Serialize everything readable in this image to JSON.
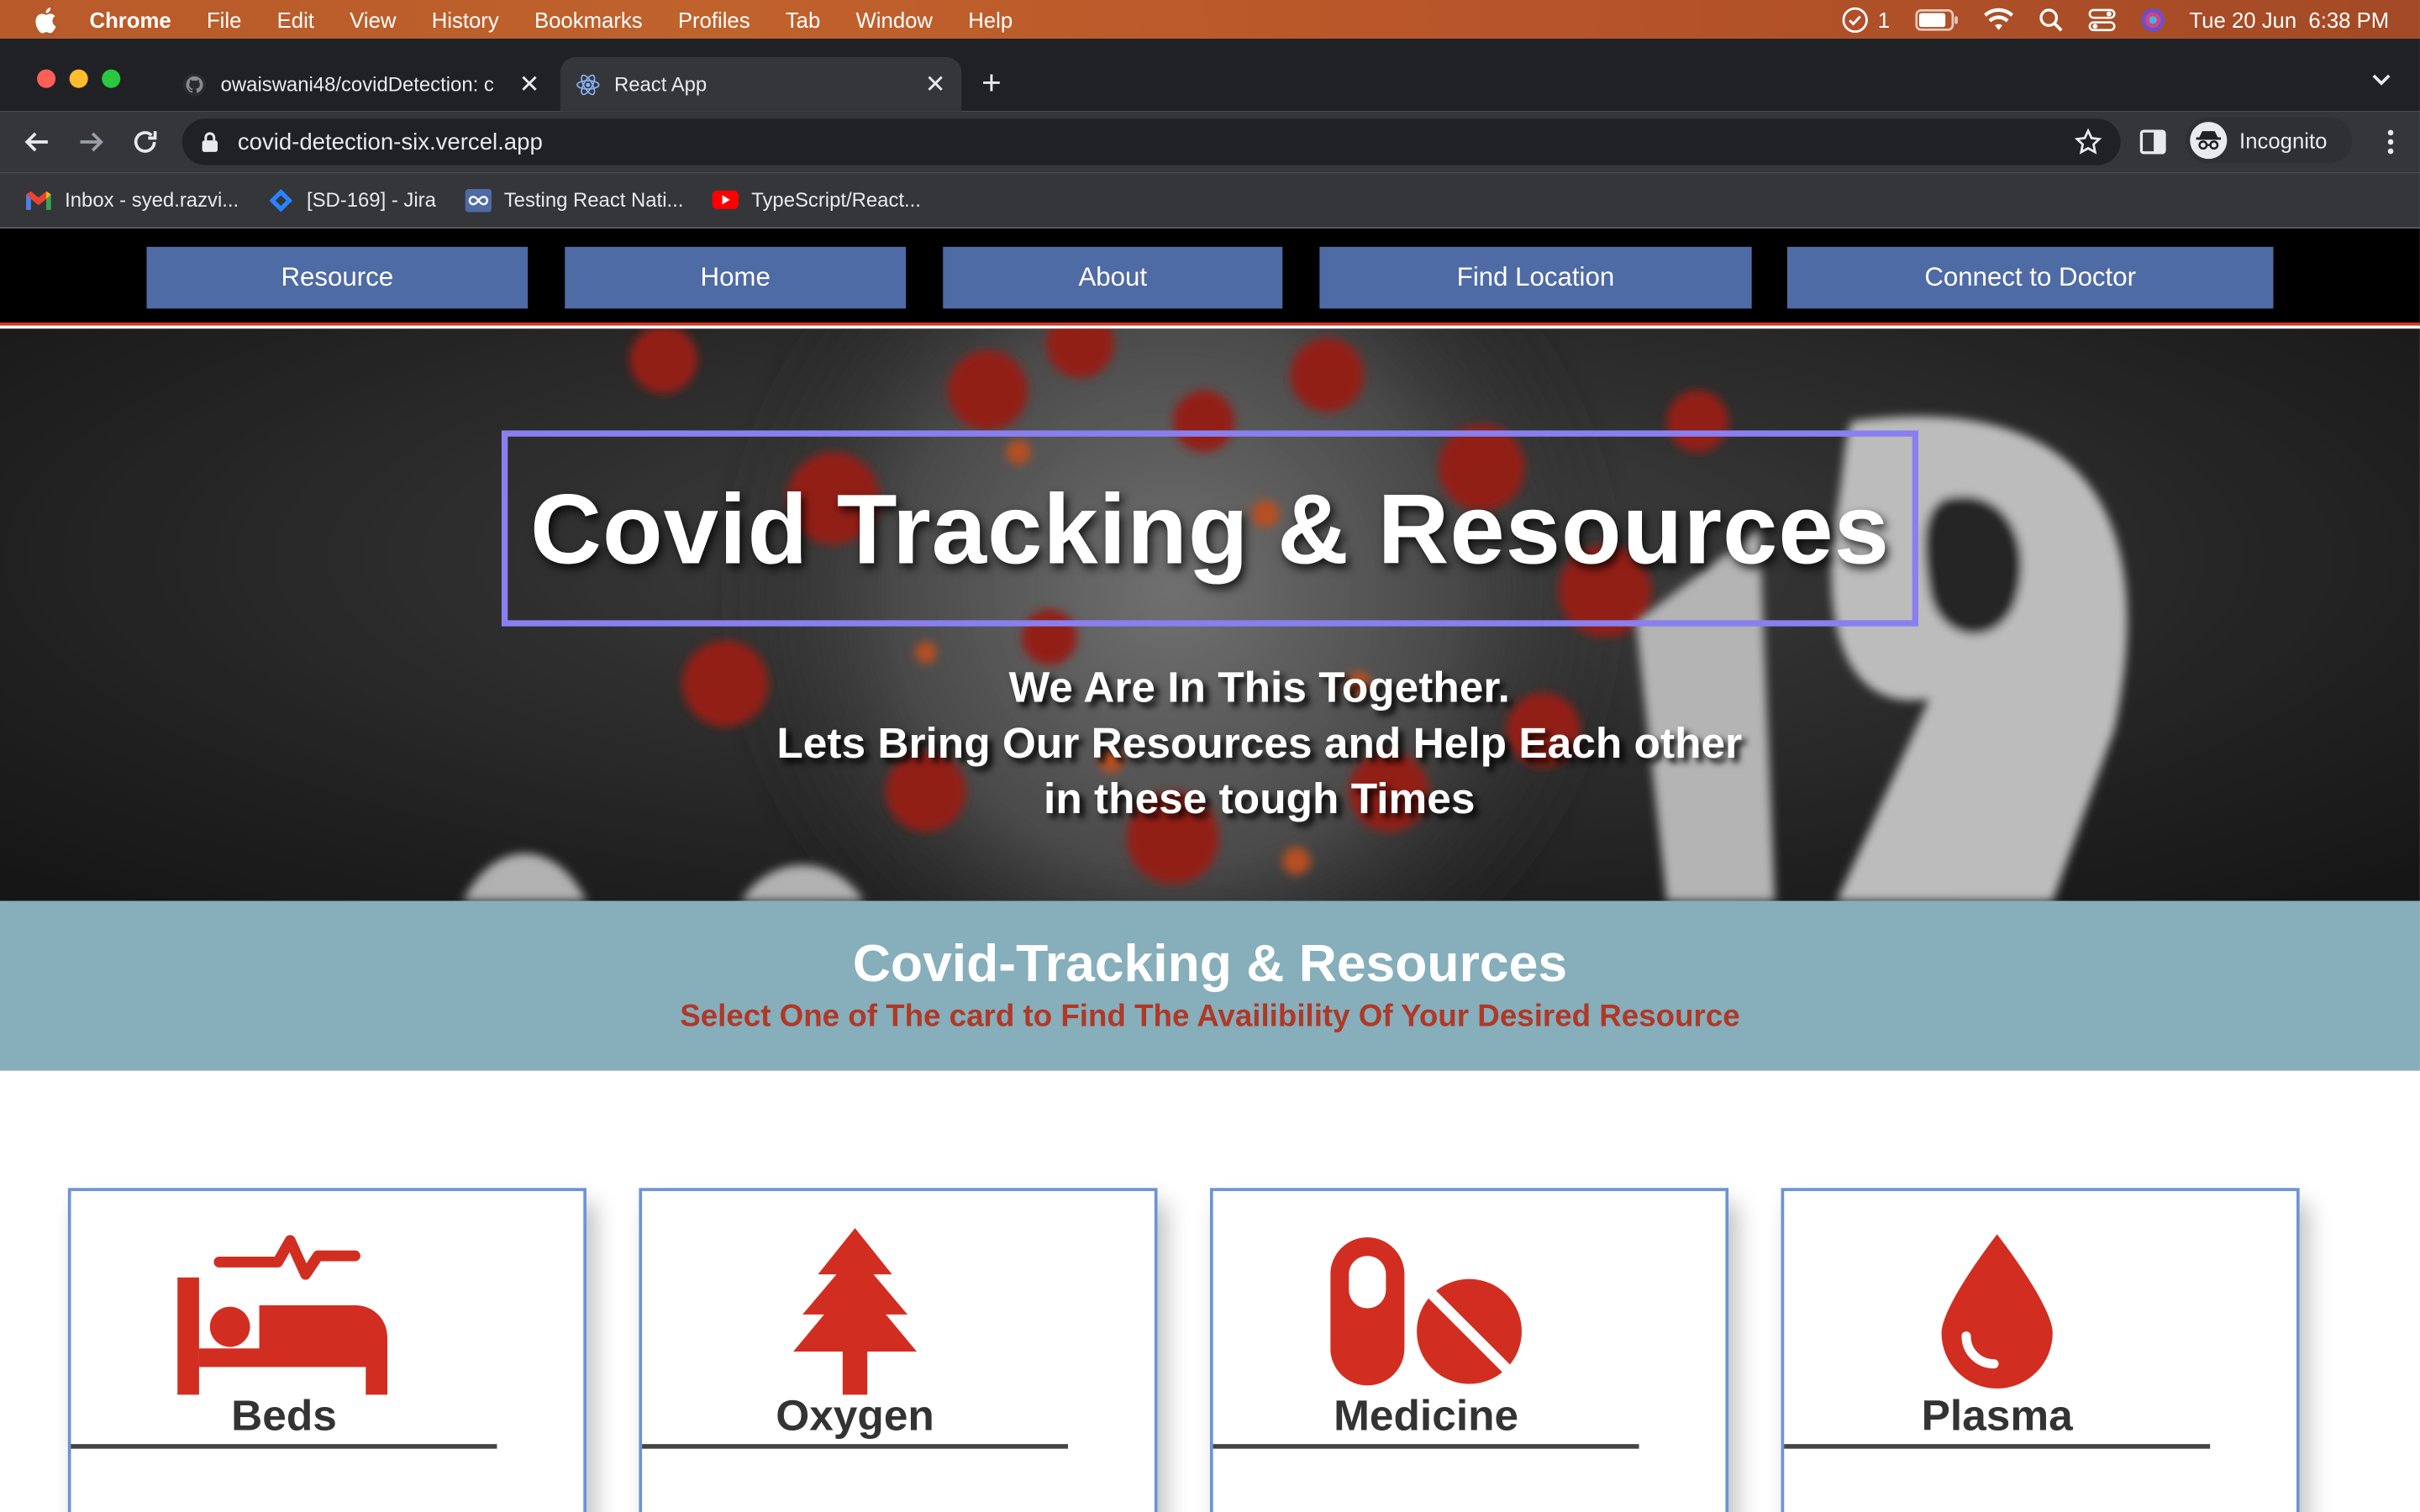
{
  "menubar": {
    "app": "Chrome",
    "items": [
      "File",
      "Edit",
      "View",
      "History",
      "Bookmarks",
      "Profiles",
      "Tab",
      "Window",
      "Help"
    ],
    "notification_count": "1",
    "datetime": "Tue 20 Jun  6:38 PM"
  },
  "tabs": [
    {
      "title": "owaiswani48/covidDetection: c",
      "icon": "github-icon"
    },
    {
      "title": "React App",
      "icon": "react-icon"
    }
  ],
  "toolbar": {
    "url": "covid-detection-six.vercel.app",
    "incognito_label": "Incognito"
  },
  "bookmarks": [
    {
      "label": "Inbox - syed.razvi...",
      "icon": "gmail-icon"
    },
    {
      "label": "[SD-169] - Jira",
      "icon": "jira-icon"
    },
    {
      "label": "Testing React Nati...",
      "icon": "infinity-icon"
    },
    {
      "label": "TypeScript/React...",
      "icon": "youtube-icon"
    }
  ],
  "site_nav": {
    "resource": "Resource",
    "home": "Home",
    "about": "About",
    "find_location": "Find Location",
    "connect_doctor": "Connect to Doctor"
  },
  "hero": {
    "title": "Covid Tracking & Resources",
    "sub_line1": "We Are In This Together.",
    "sub_line2": "Lets Bring Our Resources and Help Each other",
    "sub_line3": "in these tough Times"
  },
  "band": {
    "title": "Covid-Tracking & Resources",
    "subtitle": "Select One of The card to Find The Availibility Of Your Desired Resource"
  },
  "cards": {
    "beds": {
      "label": "Beds",
      "icon": "bed-icon"
    },
    "oxygen": {
      "label": "Oxygen",
      "icon": "tree-icon"
    },
    "medicine": {
      "label": "Medicine",
      "icon": "pills-icon"
    },
    "plasma": {
      "label": "Plasma",
      "icon": "blood-drop-icon"
    }
  },
  "colors": {
    "nav_button": "#4f6ba5",
    "accent_red": "#d12e21",
    "band": "#86aebb",
    "card_border": "#6d93d6",
    "hero_border": "#8a7ff0"
  }
}
